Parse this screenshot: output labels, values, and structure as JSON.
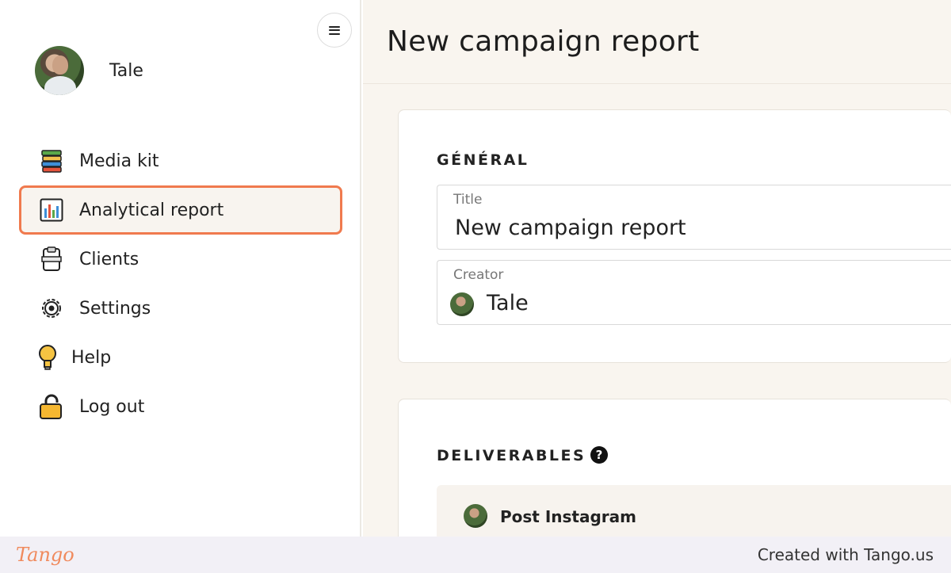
{
  "sidebar": {
    "user_name": "Tale",
    "items": [
      {
        "label": "Media kit",
        "icon": "books-icon"
      },
      {
        "label": "Analytical report",
        "icon": "bar-chart-icon",
        "active": true
      },
      {
        "label": "Clients",
        "icon": "clipboard-icon"
      },
      {
        "label": "Settings",
        "icon": "gear-icon"
      },
      {
        "label": "Help",
        "icon": "lightbulb-icon"
      },
      {
        "label": "Log out",
        "icon": "padlock-icon"
      }
    ]
  },
  "main": {
    "title": "New campaign report",
    "general": {
      "section_label": "GÉNÉRAL",
      "title_label": "Title",
      "title_value": "New campaign report",
      "creator_label": "Creator",
      "creator_value": "Tale"
    },
    "deliverables": {
      "section_label": "DELIVERABLES",
      "help_glyph": "?",
      "items": [
        {
          "name": "Post Instagram"
        }
      ]
    }
  },
  "footer": {
    "logo": "Tango",
    "credit": "Created with Tango.us"
  },
  "colors": {
    "accent": "#f07a4e",
    "main_bg": "#f9f5ef"
  }
}
